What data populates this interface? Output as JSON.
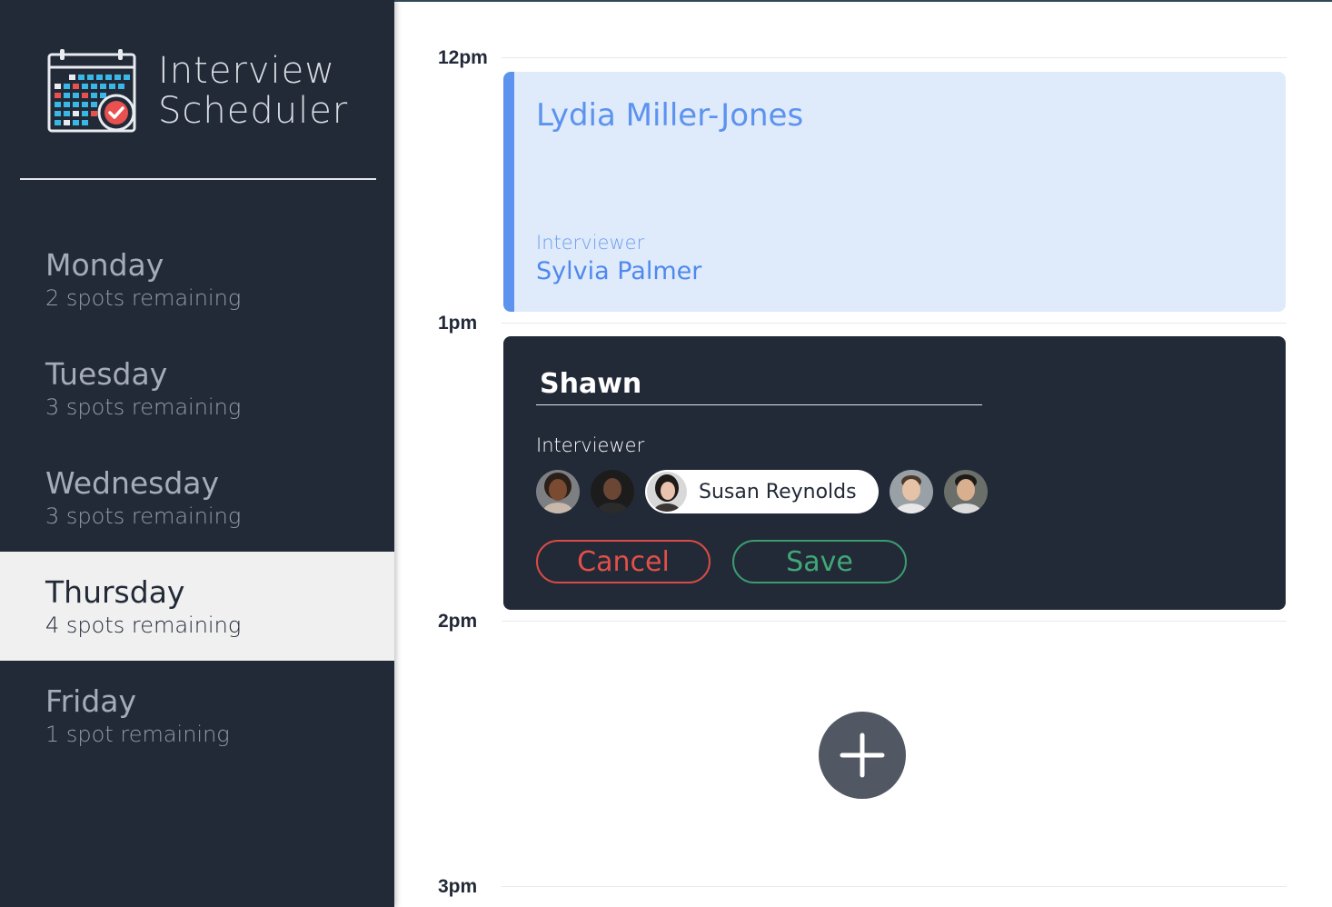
{
  "app": {
    "title_line1": "Interview",
    "title_line2": "Scheduler",
    "logo_icon": "calendar-check-icon"
  },
  "sidebar": {
    "days": [
      {
        "name": "Monday",
        "spots": "2 spots remaining",
        "selected": false
      },
      {
        "name": "Tuesday",
        "spots": "3 spots remaining",
        "selected": false
      },
      {
        "name": "Wednesday",
        "spots": "3 spots remaining",
        "selected": false
      },
      {
        "name": "Thursday",
        "spots": "4 spots remaining",
        "selected": true
      },
      {
        "name": "Friday",
        "spots": "1 spot remaining",
        "selected": false
      }
    ]
  },
  "schedule": {
    "times": [
      "12pm",
      "1pm",
      "2pm",
      "3pm"
    ],
    "booked": {
      "student": "Lydia Miller-Jones",
      "interviewer_label": "Interviewer",
      "interviewer": "Sylvia Palmer"
    },
    "form": {
      "student_value": "Shawn",
      "interviewer_label": "Interviewer",
      "selected_interviewer": "Susan Reynolds",
      "cancel_label": "Cancel",
      "save_label": "Save"
    },
    "add_icon": "plus-icon"
  },
  "colors": {
    "sidebar_bg": "#222a38",
    "accent_blue": "#5b93ef",
    "booked_bg": "#dfeafb",
    "danger": "#e25048",
    "success": "#41a876",
    "add_button": "#525863"
  }
}
